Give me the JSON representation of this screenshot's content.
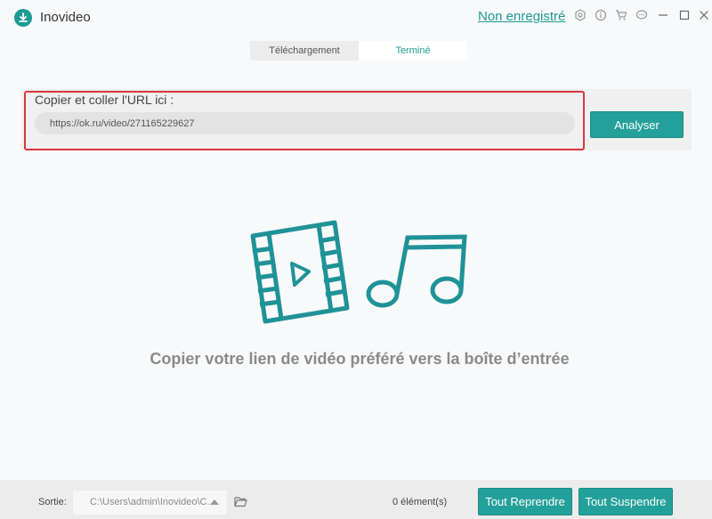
{
  "app": {
    "name": "Inovideo",
    "register_link": "Non enregistré"
  },
  "title_icons": [
    "settings-icon",
    "info-icon",
    "cart-icon",
    "feedback-icon",
    "minimize-icon",
    "maximize-icon",
    "close-icon"
  ],
  "tabs": [
    {
      "label": "Téléchargement",
      "active": false
    },
    {
      "label": "Terminé",
      "active": true
    }
  ],
  "url_section": {
    "label": "Copier et coller l'URL ici :",
    "value": "https://ok.ru/video/271165229627",
    "button": "Analyser"
  },
  "empty_state": {
    "message": "Copier votre lien de vidéo préféré vers la boîte d’entrée"
  },
  "footer": {
    "output_label": "Sortie:",
    "output_path": "C:\\Users\\admin\\Inovideo\\C...",
    "count": "0 élément(s)",
    "resume_all": "Tout Reprendre",
    "suspend_all": "Tout Suspendre"
  },
  "colors": {
    "accent": "#24a09a",
    "highlight": "#d9373d",
    "illustration": "#1f9297"
  }
}
